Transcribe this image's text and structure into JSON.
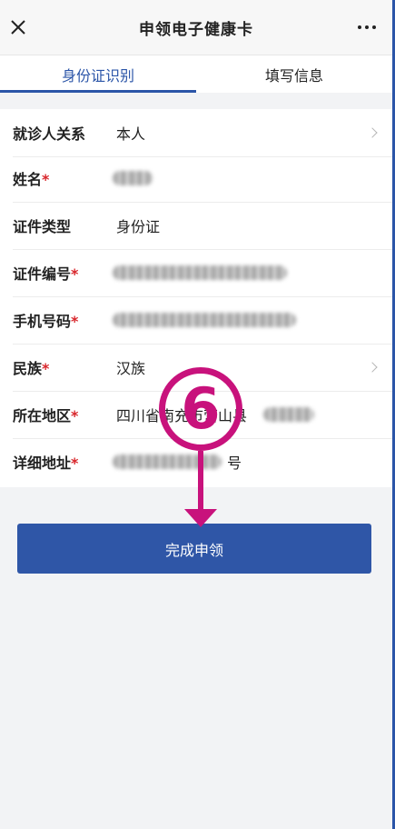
{
  "header": {
    "title": "申领电子健康卡"
  },
  "tabs": [
    {
      "label": "身份证识别",
      "active": true
    },
    {
      "label": "填写信息",
      "active": false
    }
  ],
  "form": {
    "rows": [
      {
        "label": "就诊人关系",
        "required": false,
        "value": "本人",
        "chevron": true
      },
      {
        "label": "姓名",
        "required": true,
        "value": "",
        "chevron": false
      },
      {
        "label": "证件类型",
        "required": false,
        "value": "身份证",
        "chevron": false
      },
      {
        "label": "证件编号",
        "required": true,
        "value": "",
        "chevron": false
      },
      {
        "label": "手机号码",
        "required": true,
        "value": "",
        "chevron": false
      },
      {
        "label": "民族",
        "required": true,
        "value": "汉族",
        "chevron": true
      },
      {
        "label": "所在地区",
        "required": true,
        "value": "四川省南充市营山县",
        "chevron": false
      },
      {
        "label": "详细地址",
        "required": true,
        "value": "号",
        "chevron": false
      }
    ],
    "required_mark": "*"
  },
  "submit_button": {
    "label": "完成申领"
  },
  "annotation": {
    "number": "6"
  },
  "colors": {
    "accent": "#2b55a8",
    "button": "#2f56a7",
    "required": "#d8262b",
    "annotation": "#c8127c"
  }
}
